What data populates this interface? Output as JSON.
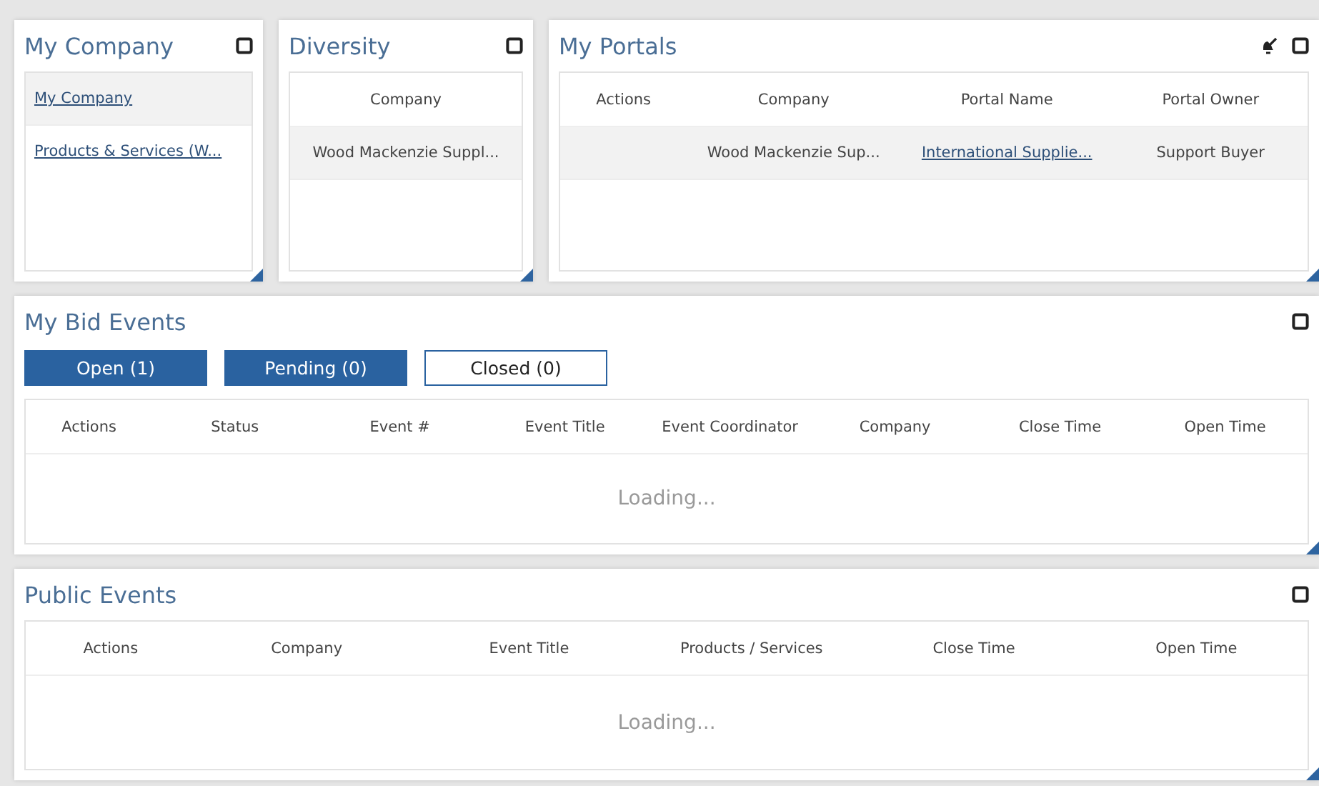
{
  "my_company": {
    "title": "My Company",
    "rows": [
      {
        "kind": "link",
        "text": "My Company"
      },
      {
        "kind": "link",
        "text": "Products & Services (W..."
      }
    ]
  },
  "diversity": {
    "title": "Diversity",
    "columns": [
      "Company"
    ],
    "rows": [
      [
        {
          "kind": "text",
          "text": "Wood Mackenzie Suppl..."
        }
      ]
    ]
  },
  "my_portals": {
    "title": "My Portals",
    "columns": [
      "Actions",
      "Company",
      "Portal Name",
      "Portal Owner"
    ],
    "rows": [
      [
        {
          "kind": "text",
          "text": ""
        },
        {
          "kind": "text",
          "text": "Wood Mackenzie Sup..."
        },
        {
          "kind": "link",
          "text": "International Supplie..."
        },
        {
          "kind": "text",
          "text": "Support Buyer"
        }
      ]
    ]
  },
  "my_bid_events": {
    "title": "My Bid Events",
    "tabs": [
      {
        "label": "Open (1)",
        "selected": true
      },
      {
        "label": "Pending (0)",
        "selected": true
      },
      {
        "label": "Closed (0)",
        "selected": false
      }
    ],
    "columns": [
      "Actions",
      "Status",
      "Event #",
      "Event Title",
      "Event Coordinator",
      "Company",
      "Close Time",
      "Open Time"
    ],
    "status": "Loading..."
  },
  "public_events": {
    "title": "Public Events",
    "columns": [
      "Actions",
      "Company",
      "Event Title",
      "Products / Services",
      "Close Time",
      "Open Time"
    ],
    "status": "Loading..."
  }
}
